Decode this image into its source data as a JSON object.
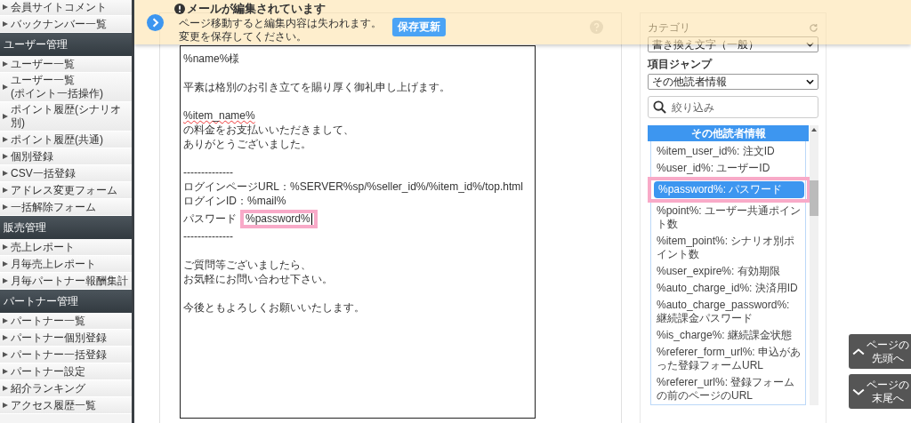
{
  "sidebar": {
    "items": [
      {
        "kind": "item",
        "label": "会員サイトコメント"
      },
      {
        "kind": "item",
        "label": "バックナンバー一覧"
      },
      {
        "kind": "header",
        "label": "ユーザー管理"
      },
      {
        "kind": "item",
        "label": "ユーザー一覧"
      },
      {
        "kind": "item",
        "label": "ユーザー一覧\n(ポイント一括操作)"
      },
      {
        "kind": "item",
        "label": "ポイント履歴(シナリオ別)"
      },
      {
        "kind": "item",
        "label": "ポイント履歴(共通)"
      },
      {
        "kind": "item",
        "label": "個別登録"
      },
      {
        "kind": "item",
        "label": "CSV一括登録"
      },
      {
        "kind": "item",
        "label": "アドレス変更フォーム"
      },
      {
        "kind": "item",
        "label": "一括解除フォーム"
      },
      {
        "kind": "header",
        "label": "販売管理"
      },
      {
        "kind": "item",
        "label": "売上レポート"
      },
      {
        "kind": "item",
        "label": "月毎売上レポート"
      },
      {
        "kind": "item",
        "label": "月毎パートナー報酬集計"
      },
      {
        "kind": "header",
        "label": "パートナー管理"
      },
      {
        "kind": "item",
        "label": "パートナー一覧"
      },
      {
        "kind": "item",
        "label": "パートナー個別登録"
      },
      {
        "kind": "item",
        "label": "パートナー一括登録"
      },
      {
        "kind": "item",
        "label": "パートナー設定"
      },
      {
        "kind": "item",
        "label": "紹介ランキング"
      },
      {
        "kind": "item",
        "label": "アクセス履歴一覧"
      }
    ]
  },
  "banner": {
    "title": "メールが編集されています",
    "message_lines": [
      "ページ移動すると編集内容は失われます。",
      "変更を保存してください。"
    ],
    "button": "保存更新"
  },
  "editor": {
    "lines": [
      {
        "kind": "text",
        "text": "%name%様"
      },
      {
        "kind": "blank"
      },
      {
        "kind": "text",
        "text": "平素は格別のお引き立てを賜り厚く御礼申し上げます。"
      },
      {
        "kind": "blank"
      },
      {
        "kind": "misspelled",
        "text": "%item_name%"
      },
      {
        "kind": "text",
        "text": "の料金をお支払いいただきまして、"
      },
      {
        "kind": "text",
        "text": "ありがとうございました。"
      },
      {
        "kind": "blank"
      },
      {
        "kind": "text",
        "text": "--------------"
      },
      {
        "kind": "text",
        "text": "ログインページURL：%SERVER%sp/%seller_id%/%item_id%/top.html"
      },
      {
        "kind": "text",
        "text": "ログインID：%mail%"
      },
      {
        "kind": "highlight",
        "label": "パスワード",
        "text": "%password%"
      },
      {
        "kind": "text",
        "text": "--------------"
      },
      {
        "kind": "blank"
      },
      {
        "kind": "text",
        "text": "ご質問等ございましたら、"
      },
      {
        "kind": "text",
        "text": "お気軽にお問い合わせ下さい。"
      },
      {
        "kind": "blank"
      },
      {
        "kind": "text",
        "text": "今後ともよろしくお願いいたします。"
      }
    ]
  },
  "panel": {
    "category_label": "カテゴリ",
    "category_value": "書き換え文字（一般）",
    "jump_label": "項目ジャンプ",
    "jump_value": "その他読者情報",
    "search": {
      "placeholder": "絞り込み"
    },
    "list_header": "その他読者情報",
    "items": [
      {
        "text": "%item_user_id%: 注文ID",
        "selected": false
      },
      {
        "text": "%user_id%: ユーザーID",
        "selected": false
      },
      {
        "text": "%password%: パスワード",
        "selected": true
      },
      {
        "text": "%point%: ユーザー共通ポイント数",
        "selected": false
      },
      {
        "text": "%item_point%: シナリオ別ポイント数",
        "selected": false
      },
      {
        "text": "%user_expire%: 有効期限",
        "selected": false
      },
      {
        "text": "%auto_charge_id%: 決済用ID",
        "selected": false
      },
      {
        "text": "%auto_charge_password%: 継続課金パスワード",
        "selected": false
      },
      {
        "text": "%is_charge%: 継続課金状態",
        "selected": false
      },
      {
        "text": "%referer_form_url%: 申込があった登録フォームURL",
        "selected": false
      },
      {
        "text": "%referer_url%: 登録フォームの前のページのURL",
        "selected": false
      }
    ]
  },
  "page_nav": [
    {
      "kind": "top",
      "lines": [
        "ページの",
        "先頭へ"
      ]
    },
    {
      "kind": "bottom",
      "lines": [
        "ページの",
        "末尾へ"
      ]
    }
  ]
}
